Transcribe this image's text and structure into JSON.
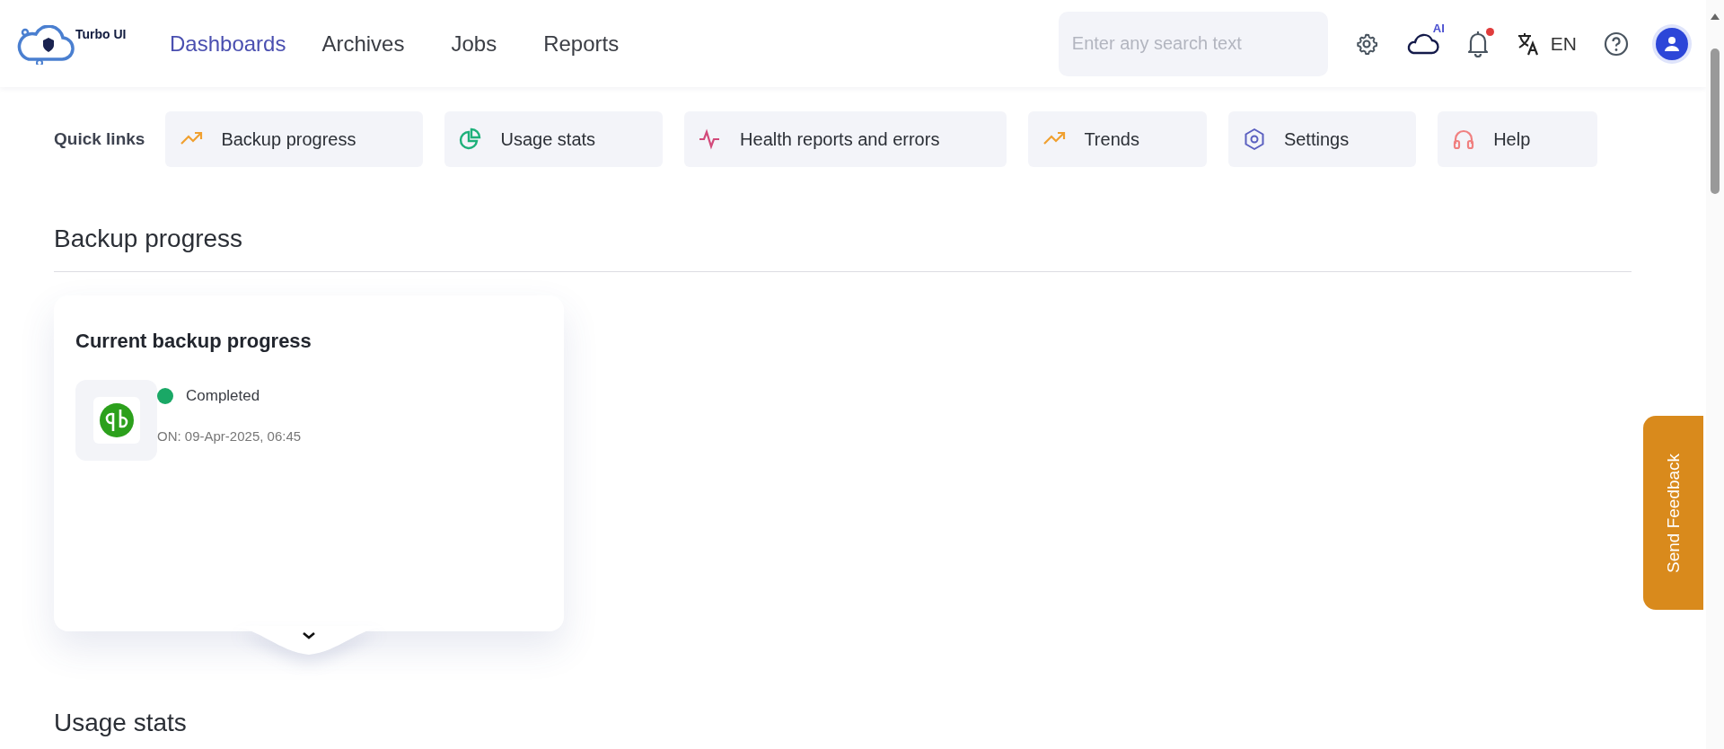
{
  "brand": {
    "name": "Turbo UI"
  },
  "nav": [
    {
      "label": "Dashboards",
      "selected": true
    },
    {
      "label": "Archives",
      "selected": false
    },
    {
      "label": "Jobs",
      "selected": false
    },
    {
      "label": "Reports",
      "selected": false
    }
  ],
  "search": {
    "placeholder": "Enter any search text"
  },
  "header_tools": {
    "ai_badge": "AI",
    "notifications_unread": true,
    "language": "EN"
  },
  "quick_links": {
    "label": "Quick links",
    "items": [
      {
        "label": "Backup progress"
      },
      {
        "label": "Usage stats"
      },
      {
        "label": "Health reports and errors"
      },
      {
        "label": "Trends"
      },
      {
        "label": "Settings"
      },
      {
        "label": "Help"
      }
    ]
  },
  "sections": [
    {
      "title": "Backup progress",
      "card": {
        "title": "Current backup progress",
        "status": {
          "label": "Completed",
          "color": "#1aa866"
        },
        "timestamp": "ON: 09-Apr-2025, 06:45"
      }
    },
    {
      "title": "Usage stats"
    }
  ],
  "feedback_tab": "Send Feedback"
}
